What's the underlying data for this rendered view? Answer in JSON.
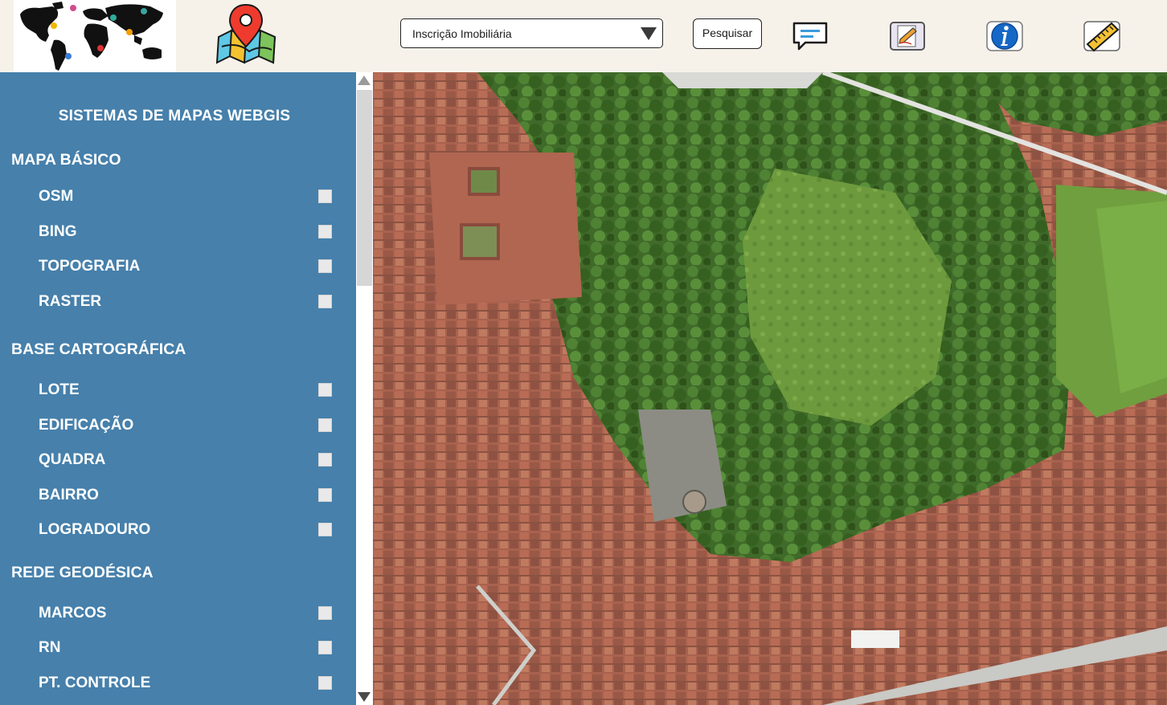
{
  "header": {
    "search_select": {
      "selected": "Inscrição Imobiliária"
    },
    "search_button_label": "Pesquisar"
  },
  "sidebar": {
    "title": "SISTEMAS DE MAPAS WEBGIS",
    "sections": [
      {
        "title": "MAPA BÁSICO",
        "items": [
          "OSM",
          "BING",
          "TOPOGRAFIA",
          "RASTER"
        ]
      },
      {
        "title": "BASE CARTOGRÁFICA",
        "items": [
          "LOTE",
          "EDIFICAÇÃO",
          "QUADRA",
          "BAIRRO",
          "LOGRADOURO"
        ]
      },
      {
        "title": "REDE GEODÉSICA",
        "items": [
          "MARCOS",
          "RN",
          "PT. CONTROLE"
        ]
      }
    ]
  },
  "colors": {
    "sidebar": "#4680ab",
    "topbar": "#f6f2ea",
    "checkbox": "#e9e9e9"
  },
  "icons": [
    "world-map-logo-icon",
    "map-pin-logo-icon",
    "chat-icon",
    "edit-document-icon",
    "info-icon",
    "ruler-icon"
  ]
}
